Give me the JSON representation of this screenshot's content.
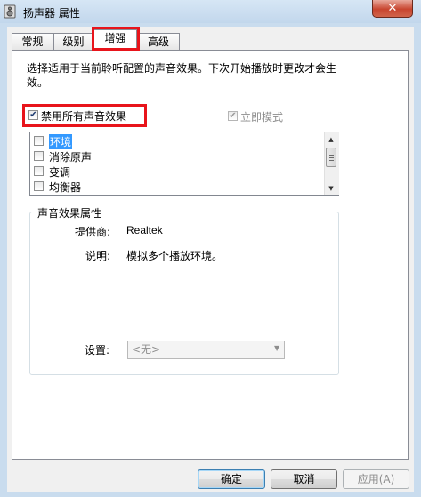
{
  "window": {
    "title": "扬声器 属性",
    "close_glyph": "✕",
    "icon": "speaker-icon"
  },
  "tabs": [
    {
      "label": "常规",
      "active": false
    },
    {
      "label": "级别",
      "active": false
    },
    {
      "label": "增强",
      "active": true
    },
    {
      "label": "高级",
      "active": false
    }
  ],
  "enhancements": {
    "description": "选择适用于当前聆听配置的声音效果。下次开始播放时更改才会生效。",
    "disable_all_label": "禁用所有声音效果",
    "disable_all_checked": true,
    "immediate_mode_label": "立即模式",
    "immediate_mode_checked": true,
    "immediate_mode_enabled": false,
    "effects": [
      {
        "label": "环境",
        "checked": false,
        "selected": true
      },
      {
        "label": "消除原声",
        "checked": false,
        "selected": false
      },
      {
        "label": "变调",
        "checked": false,
        "selected": false
      },
      {
        "label": "均衡器",
        "checked": false,
        "selected": false
      },
      {
        "label": "",
        "checked": false,
        "selected": false
      }
    ]
  },
  "properties": {
    "group_title": "声音效果属性",
    "provider_label": "提供商:",
    "provider_value": "Realtek",
    "description_label": "说明:",
    "description_value": "模拟多个播放环境。",
    "settings_label": "设置:",
    "settings_value": "<无>"
  },
  "buttons": {
    "ok": "确定",
    "cancel": "取消",
    "apply": "应用(A)"
  },
  "highlight_color": "#e8141b",
  "accent_color": "#3399ff"
}
